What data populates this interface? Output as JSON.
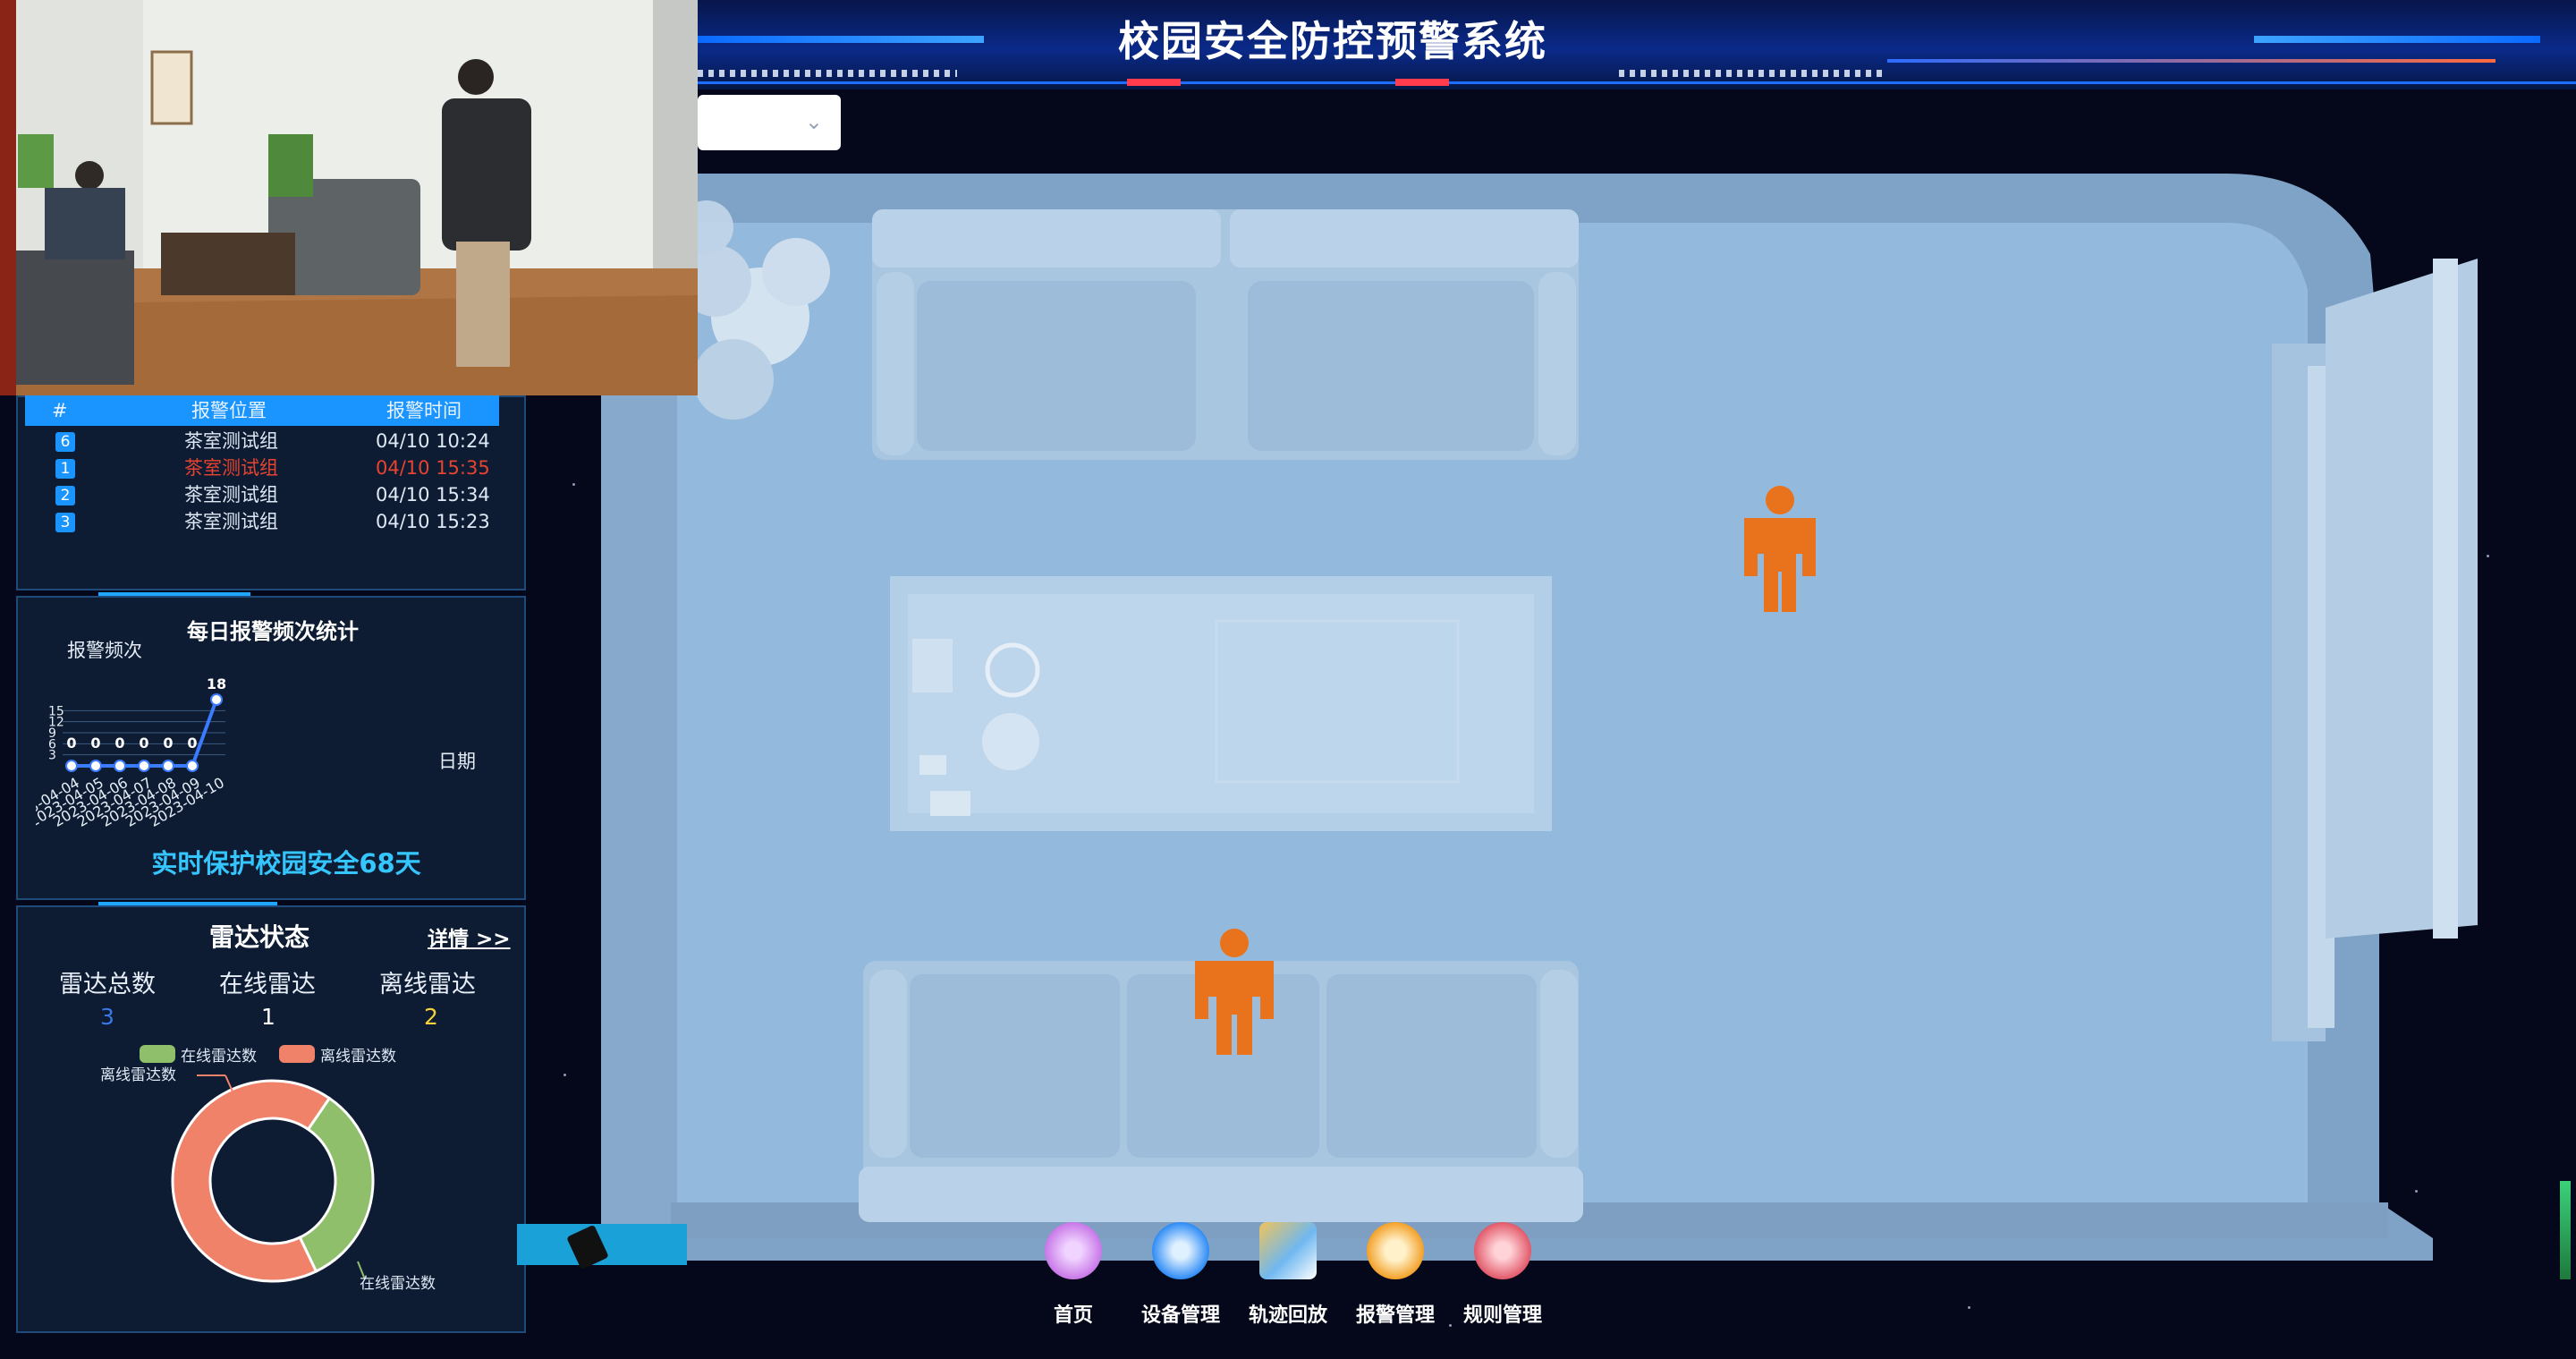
{
  "header": {
    "title": "校园安全防控预警系统"
  },
  "dropdown": {
    "value": ""
  },
  "alarm_table": {
    "columns": [
      "#",
      "报警位置",
      "报警时间"
    ],
    "rows": [
      {
        "idx": "6",
        "location": "茶室测试组",
        "time": "04/10 10:24",
        "highlight": false
      },
      {
        "idx": "1",
        "location": "茶室测试组",
        "time": "04/10 15:35",
        "highlight": true
      },
      {
        "idx": "2",
        "location": "茶室测试组",
        "time": "04/10 15:34",
        "highlight": false
      },
      {
        "idx": "3",
        "location": "茶室测试组",
        "time": "04/10 15:23",
        "highlight": false
      }
    ]
  },
  "chart_data": {
    "type": "line",
    "title": "每日报警频次统计",
    "ylabel": "报警频次",
    "xlabel": "日期",
    "categories": [
      "2023-04-04",
      "2023-04-05",
      "2023-04-06",
      "2023-04-07",
      "2023-04-08",
      "2023-04-09",
      "2023-04-10"
    ],
    "values": [
      0,
      0,
      0,
      0,
      0,
      0,
      18
    ],
    "yticks": [
      "15",
      "12",
      "9",
      "6",
      "3"
    ],
    "ylim": [
      0,
      18
    ]
  },
  "safety_banner": "实时保护校园安全68天",
  "radar": {
    "title": "雷达状态",
    "details_link": "详情 >>",
    "total_label": "雷达总数",
    "online_label": "在线雷达",
    "offline_label": "离线雷达",
    "total_value": "3",
    "online_value": "1",
    "offline_value": "2",
    "legend_online": "在线雷达数",
    "legend_offline": "离线雷达数",
    "donut_label_offline": "离线雷达数",
    "donut_label_online": "在线雷达数",
    "donut": {
      "online": 1,
      "offline": 2
    },
    "colors": {
      "online": "#8fbf6a",
      "offline": "#f0826a"
    }
  },
  "menu": [
    {
      "label": "首页",
      "icon": "home-icon",
      "color": "#c978e8"
    },
    {
      "label": "设备管理",
      "icon": "gear-icon",
      "color": "#2f8cf5"
    },
    {
      "label": "轨迹回放",
      "icon": "map-icon",
      "color": "#6fb8f0"
    },
    {
      "label": "报警管理",
      "icon": "alarm-icon",
      "color": "#f3a12a"
    },
    {
      "label": "规则管理",
      "icon": "rule-icon",
      "color": "#e25a6a"
    }
  ],
  "colors": {
    "accent": "#1a94ff",
    "person": "#e8731c",
    "room": "#8fb3d4"
  }
}
